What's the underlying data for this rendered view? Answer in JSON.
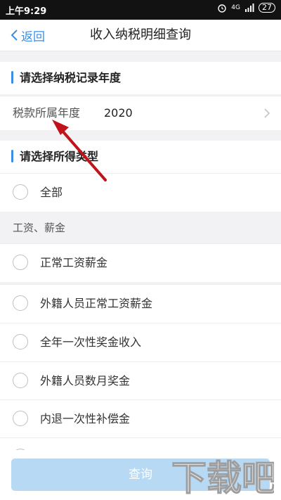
{
  "status_bar": {
    "time": "上午9:29",
    "network": "4G",
    "battery": "27"
  },
  "nav": {
    "back_label": "返回",
    "title": "收入纳税明细查询"
  },
  "year_section": {
    "heading": "请选择纳税记录年度",
    "row_label": "税款所属年度",
    "row_value": "2020"
  },
  "type_section": {
    "heading": "请选择所得类型",
    "all_option": "全部",
    "group_label": "工资、薪金",
    "options": [
      "正常工资薪金",
      "外籍人员正常工资薪金",
      "全年一次性奖金收入",
      "外籍人员数月奖金",
      "内退一次性补偿金"
    ]
  },
  "footer": {
    "query_label": "查询"
  },
  "accent_color": "#3a8ee6",
  "annotation_color": "#c0141a",
  "watermark": {
    "brand_text": "下载吧"
  },
  "icons": [
    "back-chevron-icon",
    "chevron-right-icon",
    "alarm-icon",
    "signal-icon",
    "battery-icon",
    "radio-icon"
  ]
}
